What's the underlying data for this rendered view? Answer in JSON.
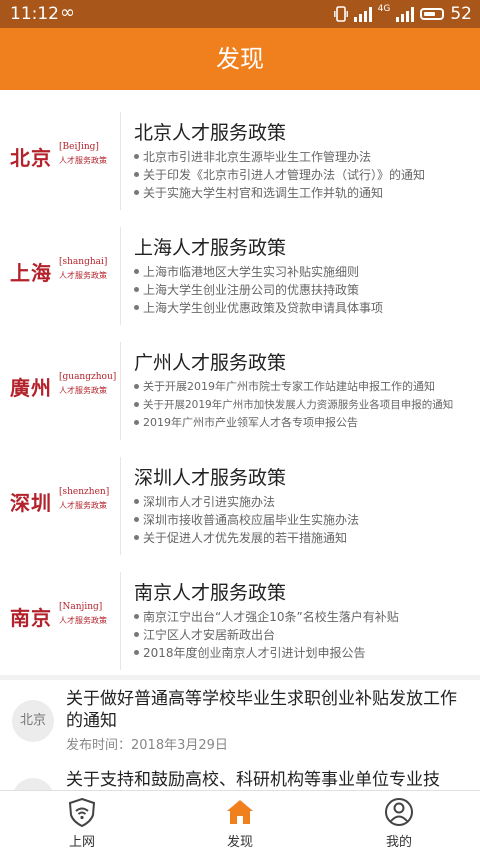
{
  "status": {
    "time": "11:12",
    "signal": "4G",
    "battery": "52"
  },
  "header": {
    "title": "发现"
  },
  "cards": [
    {
      "logo_cn": "北京",
      "logo_en": "[BeiJing]",
      "logo_sub": "人才服务政策",
      "title": "北京人才服务政策",
      "items": [
        "北京市引进非北京生源毕业生工作管理办法",
        "关于印发《北京市引进人才管理办法（试行）》的通知",
        "关于实施大学生村官和选调生工作并轨的通知"
      ]
    },
    {
      "logo_cn": "上海",
      "logo_en": "[shanghai]",
      "logo_sub": "人才服务政策",
      "title": "上海人才服务政策",
      "items": [
        "上海市临港地区大学生实习补贴实施细则",
        "上海大学生创业注册公司的优惠扶持政策",
        "上海大学生创业优惠政策及贷款申请具体事项"
      ]
    },
    {
      "logo_cn": "廣州",
      "logo_en": "[guangzhou]",
      "logo_sub": "人才服务政策",
      "title": "广州人才服务政策",
      "items": [
        "关于开展2019年广州市院士专家工作站建站申报工作的通知",
        "关于开展2019年广州市加快发展人力资源服务业各项目申报的通知",
        "2019年广州市产业领军人才各专项申报公告"
      ]
    },
    {
      "logo_cn": "深圳",
      "logo_en": "[shenzhen]",
      "logo_sub": "人才服务政策",
      "title": "深圳人才服务政策",
      "items": [
        "深圳市人才引进实施办法",
        "深圳市接收普通高校应届毕业生实施办法",
        "关于促进人才优先发展的若干措施通知"
      ]
    },
    {
      "logo_cn": "南京",
      "logo_en": "[Nanjing]",
      "logo_sub": "人才服务政策",
      "title": "南京人才服务政策",
      "items": [
        "南京江宁出台“人才强企10条”名校生落户有补贴",
        "江宁区人才安居新政出台",
        "2018年度创业南京人才引进计划申报公告"
      ]
    }
  ],
  "news": [
    {
      "badge": "北京",
      "title": "关于做好普通高等学校毕业生求职创业补贴发放工作的通知",
      "date": "发布时间：2018年3月29日"
    },
    {
      "badge": "",
      "title": "关于支持和鼓励高校、科研机构等事业单位专业技",
      "date": ""
    }
  ],
  "tabs": [
    {
      "label": "上网",
      "icon": "wifi-shield-icon"
    },
    {
      "label": "发现",
      "icon": "home-icon"
    },
    {
      "label": "我的",
      "icon": "user-icon"
    }
  ],
  "colors": {
    "accent": "#f0801e",
    "status_bar": "#a8561a",
    "logo_red": "#b3222b"
  }
}
